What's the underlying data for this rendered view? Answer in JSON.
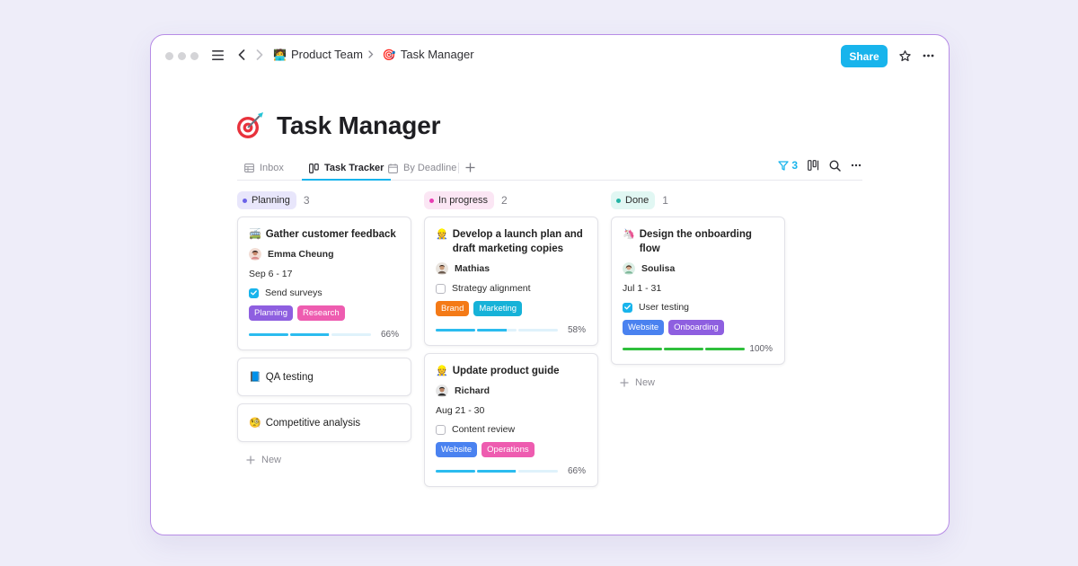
{
  "window": {
    "breadcrumb": [
      {
        "label": "Product Team",
        "emoji": "🧑‍💻"
      },
      {
        "label": "Task Manager",
        "emoji": "🎯"
      }
    ],
    "share_label": "Share"
  },
  "page": {
    "title": "Task Manager",
    "title_icon": "target-dart-icon"
  },
  "views": {
    "tabs": [
      {
        "label": "Inbox",
        "icon": "table-icon",
        "active": false
      },
      {
        "label": "Task Tracker",
        "icon": "board-icon",
        "active": true
      },
      {
        "label": "By Deadline",
        "icon": "calendar-icon",
        "active": false
      }
    ],
    "filter_count": "3"
  },
  "colors": {
    "accent": "#18b4ec",
    "planning_pill": "#e8e6fb",
    "planning_dot": "#6b62e8",
    "inprogress_pill": "#fbe6f4",
    "inprogress_dot": "#e83fb3",
    "done_pill": "#e1f7f3",
    "done_dot": "#22b3a4",
    "tag_planning": "#8e5fe0",
    "tag_research": "#ee5cb0",
    "tag_brand": "#f47a17",
    "tag_marketing": "#16b2d8",
    "tag_website": "#4a82f0",
    "tag_operations": "#ee5cb0",
    "tag_onboarding": "#8e5fe0",
    "progress_blue": "#2bbcef",
    "progress_green": "#2fbf3c"
  },
  "board": {
    "new_label": "New",
    "columns": [
      {
        "name": "Planning",
        "count": "3",
        "cards": [
          {
            "emoji": "🚎",
            "title": "Gather customer feedback",
            "assignee": "Emma Cheung",
            "date": "Sep 6 - 17",
            "subtask": "Send surveys",
            "subtask_done": true,
            "tags": [
              "Planning",
              "Research"
            ],
            "progress": 0.66,
            "progress_label": "66%"
          },
          {
            "emoji": "📘",
            "title": "QA testing"
          },
          {
            "emoji": "🧐",
            "title": "Competitive analysis"
          }
        ]
      },
      {
        "name": "In progress",
        "count": "2",
        "cards": [
          {
            "emoji": "👷",
            "title": "Develop a launch plan and draft marketing copies",
            "assignee": "Mathias",
            "subtask": "Strategy alignment",
            "subtask_done": false,
            "tags": [
              "Brand",
              "Marketing"
            ],
            "progress": 0.58,
            "progress_label": "58%"
          },
          {
            "emoji": "👷",
            "title": "Update product guide",
            "assignee": "Richard",
            "date": "Aug 21 - 30",
            "subtask": "Content review",
            "subtask_done": false,
            "tags": [
              "Website",
              "Operations"
            ],
            "progress": 0.66,
            "progress_label": "66%"
          }
        ]
      },
      {
        "name": "Done",
        "count": "1",
        "cards": [
          {
            "emoji": "🦄",
            "title": "Design the onboarding flow",
            "assignee": "Soulisa",
            "date": "Jul 1 - 31",
            "subtask": "User testing",
            "subtask_done": true,
            "tags": [
              "Website",
              "Onboarding"
            ],
            "progress": 1.0,
            "progress_label": "100%"
          }
        ]
      }
    ]
  }
}
